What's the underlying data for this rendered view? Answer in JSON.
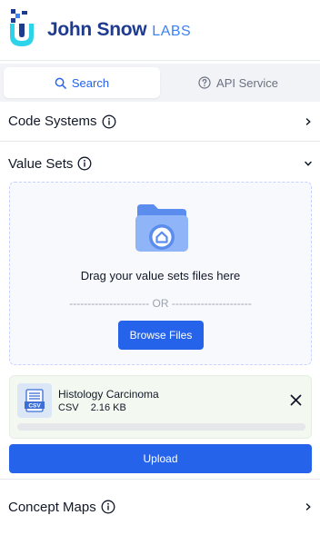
{
  "brand": {
    "main": "John Snow",
    "sub": "LABS"
  },
  "tabs": [
    {
      "label": "Search",
      "icon": "search-icon",
      "active": true
    },
    {
      "label": "API Service",
      "icon": "help-circle-icon",
      "active": false
    }
  ],
  "sections": {
    "code_systems": {
      "title": "Code Systems",
      "expanded": false
    },
    "value_sets": {
      "title": "Value Sets",
      "expanded": true
    },
    "concept_maps": {
      "title": "Concept Maps",
      "expanded": false
    }
  },
  "dropzone": {
    "instruction": "Drag your value sets files here",
    "or_text": "---------------------- OR ----------------------",
    "browse_label": "Browse Files"
  },
  "file": {
    "name": "Histology Carcinoma",
    "type": "CSV",
    "size": "2.16 KB",
    "icon_label": "CSV",
    "progress": 0
  },
  "upload_label": "Upload",
  "colors": {
    "accent": "#2563eb",
    "brand_dark": "#1f3b8f",
    "brand_light": "#3b82f6"
  }
}
